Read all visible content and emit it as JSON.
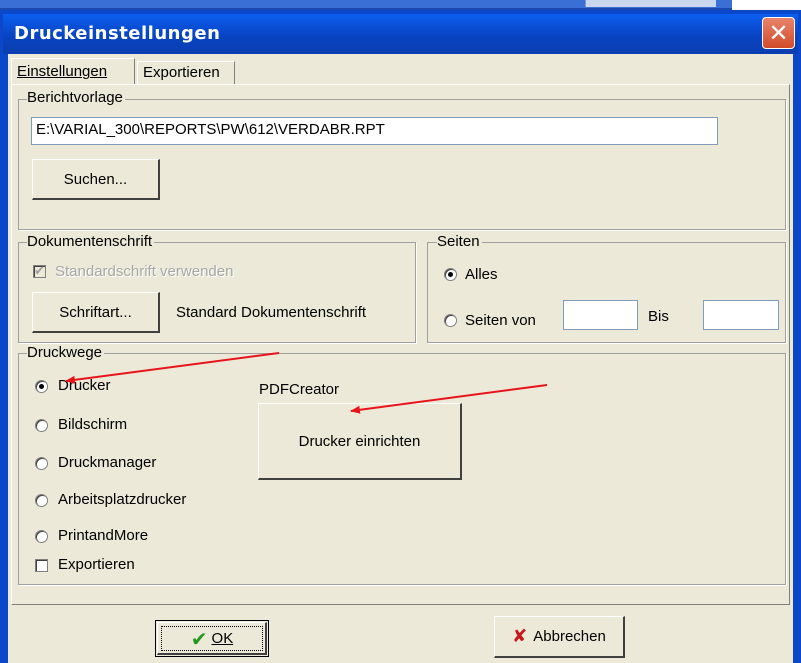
{
  "window": {
    "title": "Druckeinstellungen",
    "close_glyph": "✕"
  },
  "tabs": [
    {
      "label": "Einstellungen",
      "active": true
    },
    {
      "label": "Exportieren",
      "active": false
    }
  ],
  "berichtvorlage": {
    "legend": "Berichtvorlage",
    "path_value": "E:\\VARIAL_300\\REPORTS\\PW\\612\\VERDABR.RPT",
    "search_button": "Suchen..."
  },
  "dokumentenschrift": {
    "legend": "Dokumentenschrift",
    "standard_checkbox": "Standardschrift verwenden",
    "standard_checked": true,
    "font_button": "Schriftart...",
    "font_name": "Standard Dokumentenschrift"
  },
  "seiten": {
    "legend": "Seiten",
    "all_label": "Alles",
    "range_label": "Seiten von",
    "to_label": "Bis",
    "from_value": "",
    "to_value": ""
  },
  "druckwege": {
    "legend": "Druckwege",
    "options": [
      {
        "label": "Drucker",
        "selected": true
      },
      {
        "label": "Bildschirm",
        "selected": false
      },
      {
        "label": "Druckmanager",
        "selected": false
      },
      {
        "label": "Arbeitsplatzdrucker",
        "selected": false
      },
      {
        "label": "PrintandMore",
        "selected": false
      }
    ],
    "export_checkbox": "Exportieren",
    "export_checked": false,
    "printer_name": "PDFCreator",
    "setup_button": "Drucker einrichten"
  },
  "footer": {
    "ok_label": "OK",
    "cancel_label": "Abbrechen"
  },
  "colors": {
    "title_bar": "#0a47c9",
    "face": "#ece9d8",
    "annotation_arrow": "#e8141b",
    "ok_check": "#1f9a1f",
    "cancel_x": "#c8161d"
  }
}
